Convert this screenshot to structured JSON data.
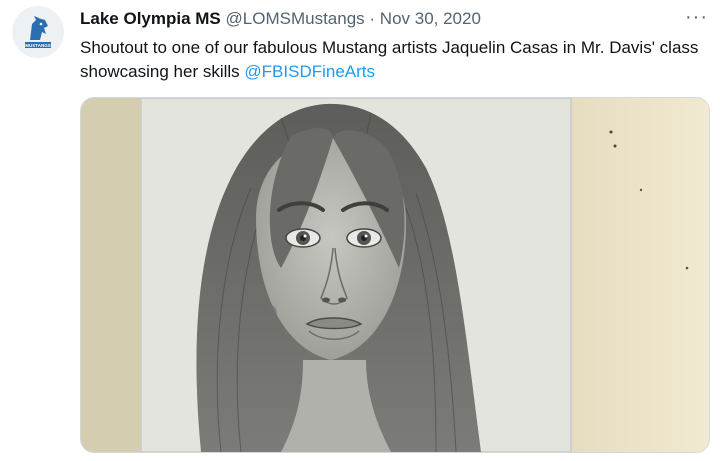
{
  "tweet": {
    "author_name": "Lake Olympia MS",
    "handle": "@LOMSMustangs",
    "separator": "·",
    "date": "Nov 30, 2020",
    "more_label": "···",
    "text": "Shoutout to one of our fabulous Mustang artists Jaquelin Casas in Mr. Davis' class showcasing her skills ",
    "mention": "@FBISDFineArts",
    "avatar_logo_text": "MUSTANGS",
    "media_icon": "pencil-portrait-drawing"
  },
  "colors": {
    "link": "#1d9bf0",
    "secondary_text": "#536471",
    "paper": "#e9e9e4",
    "wall": "#efe5c8"
  }
}
